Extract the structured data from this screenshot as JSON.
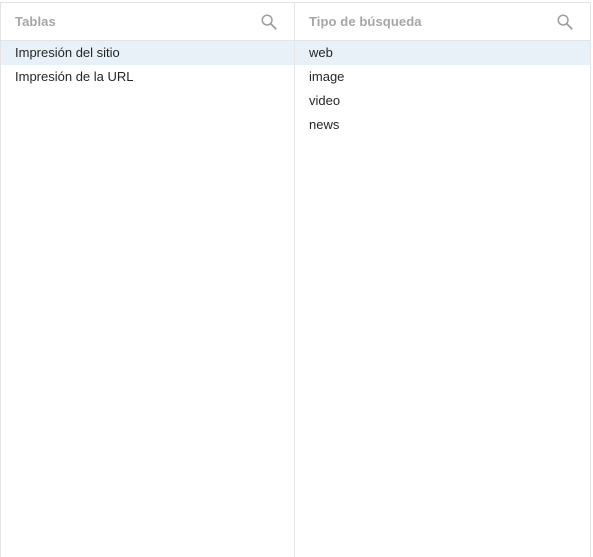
{
  "tables_panel": {
    "title": "Tablas",
    "search_icon": "search-icon",
    "items": [
      {
        "label": "Impresión del sitio",
        "selected": true
      },
      {
        "label": "Impresión de la URL",
        "selected": false
      }
    ]
  },
  "search_type_panel": {
    "title": "Tipo de búsqueda",
    "search_icon": "search-icon",
    "items": [
      {
        "label": "web",
        "selected": true
      },
      {
        "label": "image",
        "selected": false
      },
      {
        "label": "video",
        "selected": false
      },
      {
        "label": "news",
        "selected": false
      }
    ]
  },
  "colors": {
    "selected_row": "#e8f1f8",
    "header_text": "#a6a6a6",
    "icon": "#9e9e9e",
    "divider": "#e3e3e3"
  }
}
